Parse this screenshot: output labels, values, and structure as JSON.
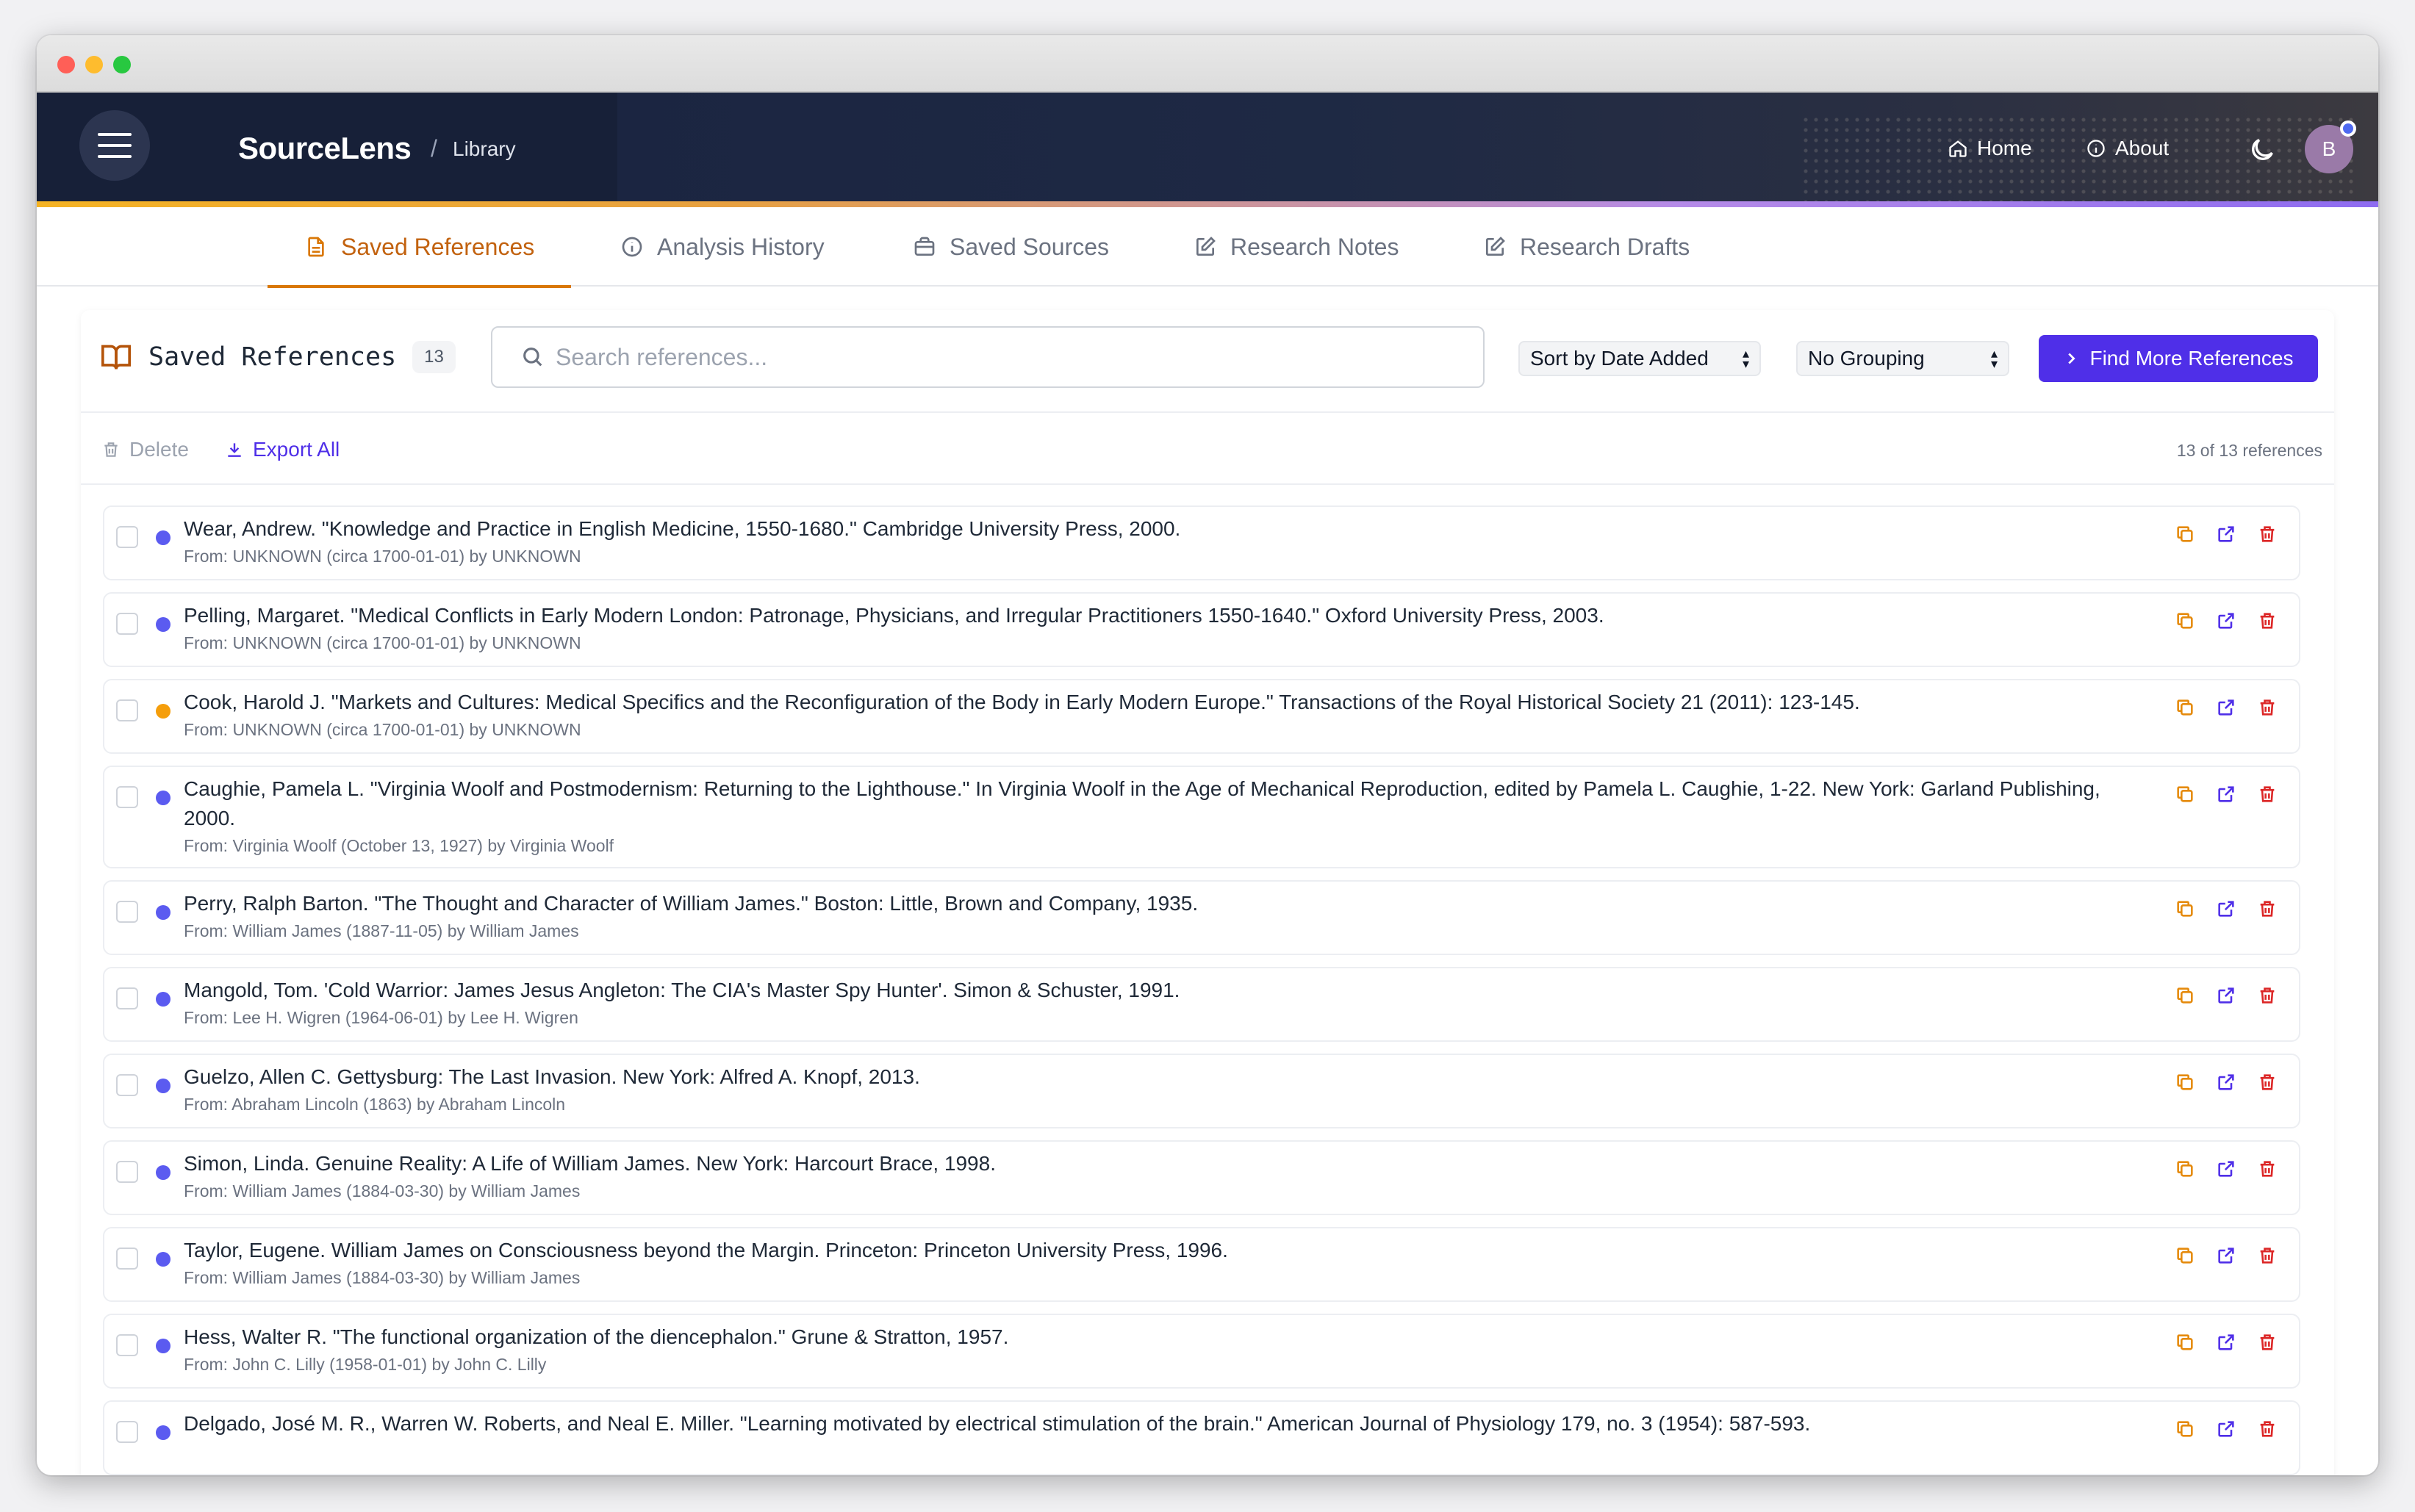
{
  "app": {
    "brand": "SourceLens",
    "separator": "/",
    "section": "Library",
    "nav": {
      "home": "Home",
      "about": "About"
    },
    "avatar_initial": "B"
  },
  "tabs": [
    {
      "label": "Saved References",
      "icon": "document-icon",
      "active": true
    },
    {
      "label": "Analysis History",
      "icon": "info-icon",
      "active": false
    },
    {
      "label": "Saved Sources",
      "icon": "briefcase-icon",
      "active": false
    },
    {
      "label": "Research Notes",
      "icon": "edit-icon",
      "active": false
    },
    {
      "label": "Research Drafts",
      "icon": "edit-icon",
      "active": false
    }
  ],
  "panel": {
    "title": "Saved References",
    "count": "13",
    "search_placeholder": "Search references...",
    "sort_label": "Sort by Date Added",
    "group_label": "No Grouping",
    "find_button": "Find More References",
    "delete_label": "Delete",
    "export_label": "Export All",
    "result_count": "13 of 13 references"
  },
  "colors": {
    "accent": "#4f2fe8",
    "active_tab": "#c2620f",
    "dot_purple": "#5b5bf0",
    "dot_orange": "#f59e0b",
    "copy_icon": "#e58a0c",
    "open_icon": "#4f2fe8",
    "delete_icon": "#dc2626"
  },
  "references": [
    {
      "citation": "Wear, Andrew. \"Knowledge and Practice in English Medicine, 1550-1680.\" Cambridge University Press, 2000.",
      "from": "From: UNKNOWN (circa 1700-01-01) by UNKNOWN",
      "dot": "purple"
    },
    {
      "citation": "Pelling, Margaret. \"Medical Conflicts in Early Modern London: Patronage, Physicians, and Irregular Practitioners 1550-1640.\" Oxford University Press, 2003.",
      "from": "From: UNKNOWN (circa 1700-01-01) by UNKNOWN",
      "dot": "purple"
    },
    {
      "citation": "Cook, Harold J. \"Markets and Cultures: Medical Specifics and the Reconfiguration of the Body in Early Modern Europe.\" Transactions of the Royal Historical Society 21 (2011): 123-145.",
      "from": "From: UNKNOWN (circa 1700-01-01) by UNKNOWN",
      "dot": "orange"
    },
    {
      "citation": "Caughie, Pamela L. \"Virginia Woolf and Postmodernism: Returning to the Lighthouse.\" In Virginia Woolf in the Age of Mechanical Reproduction, edited by Pamela L. Caughie, 1-22. New York: Garland Publishing, 2000.",
      "from": "From: Virginia Woolf (October 13, 1927) by Virginia Woolf",
      "dot": "purple"
    },
    {
      "citation": "Perry, Ralph Barton. \"The Thought and Character of William James.\" Boston: Little, Brown and Company, 1935.",
      "from": "From: William James (1887-11-05) by William James",
      "dot": "purple"
    },
    {
      "citation": "Mangold, Tom. 'Cold Warrior: James Jesus Angleton: The CIA's Master Spy Hunter'. Simon & Schuster, 1991.",
      "from": "From: Lee H. Wigren (1964-06-01) by Lee H. Wigren",
      "dot": "purple"
    },
    {
      "citation": "Guelzo, Allen C. Gettysburg: The Last Invasion. New York: Alfred A. Knopf, 2013.",
      "from": "From: Abraham Lincoln (1863) by Abraham Lincoln",
      "dot": "purple"
    },
    {
      "citation": "Simon, Linda. Genuine Reality: A Life of William James. New York: Harcourt Brace, 1998.",
      "from": "From: William James (1884-03-30) by William James",
      "dot": "purple"
    },
    {
      "citation": "Taylor, Eugene. William James on Consciousness beyond the Margin. Princeton: Princeton University Press, 1996.",
      "from": "From: William James (1884-03-30) by William James",
      "dot": "purple"
    },
    {
      "citation": "Hess, Walter R. \"The functional organization of the diencephalon.\" Grune & Stratton, 1957.",
      "from": "From: John C. Lilly (1958-01-01) by John C. Lilly",
      "dot": "purple"
    },
    {
      "citation": "Delgado, José M. R., Warren W. Roberts, and Neal E. Miller. \"Learning motivated by electrical stimulation of the brain.\" American Journal of Physiology 179, no. 3 (1954): 587-593.",
      "from": "",
      "dot": "purple"
    }
  ]
}
